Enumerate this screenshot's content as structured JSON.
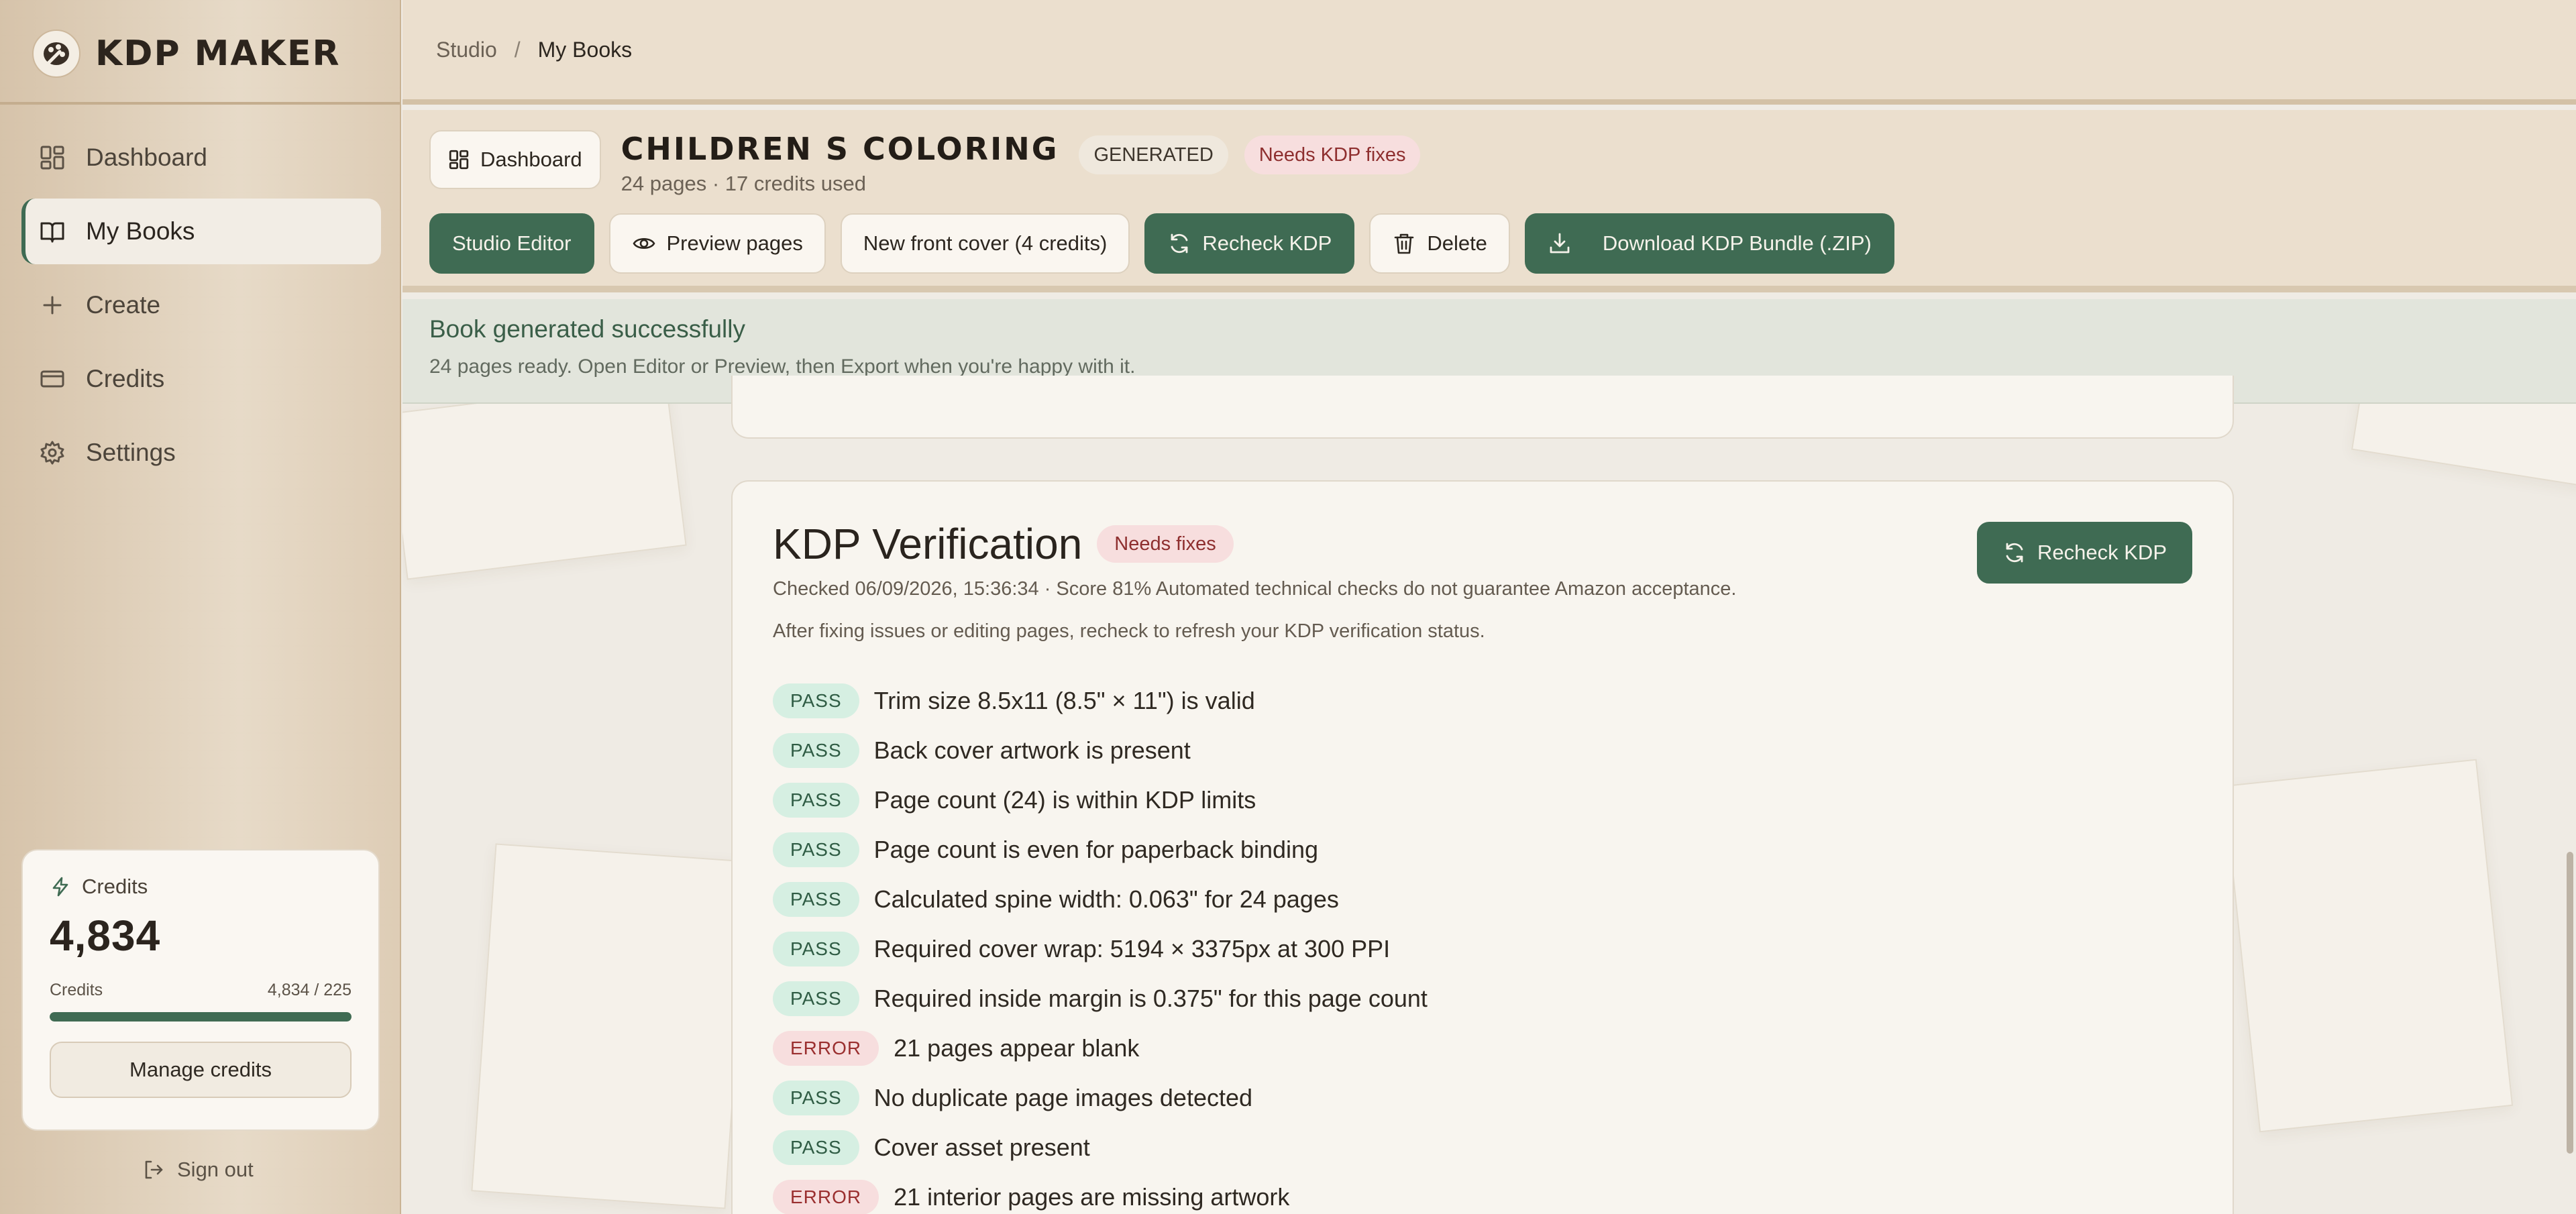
{
  "brand": {
    "name": "KDP MAKER",
    "logo_icon": "palette-brush-icon"
  },
  "sidebar": {
    "items": [
      {
        "label": "Dashboard",
        "icon": "dashboard-grid-icon",
        "active": false
      },
      {
        "label": "My Books",
        "icon": "book-open-icon",
        "active": true
      },
      {
        "label": "Create",
        "icon": "plus-icon",
        "active": false
      },
      {
        "label": "Credits",
        "icon": "credit-card-icon",
        "active": false
      },
      {
        "label": "Settings",
        "icon": "gear-icon",
        "active": false
      }
    ],
    "credits_card": {
      "heading": "Credits",
      "amount": "4,834",
      "row_label": "Credits",
      "row_value": "4,834 / 225",
      "progress": 1.0,
      "button_label": "Manage credits"
    },
    "signout_label": "Sign out"
  },
  "breadcrumb": {
    "root": "Studio",
    "separator": "/",
    "current": "My Books"
  },
  "book": {
    "back_button": "Dashboard",
    "title": "CHILDREN S COLORING",
    "subtitle": "24 pages · 17 credits used",
    "status_pill": "GENERATED",
    "warning_pill": "Needs KDP fixes"
  },
  "actions": {
    "studio_editor": "Studio Editor",
    "preview_pages": "Preview pages",
    "new_front_cover": "New front cover (4 credits)",
    "recheck_kdp": "Recheck KDP",
    "delete": "Delete",
    "download": "Download KDP Bundle (.ZIP)"
  },
  "alert": {
    "title": "Book generated successfully",
    "description": "24 pages ready. Open Editor or Preview, then Export when you're happy with it."
  },
  "verification": {
    "title": "KDP Verification",
    "badge": "Needs fixes",
    "recheck_label": "Recheck KDP",
    "meta": "Checked 06/09/2026, 15:36:34 · Score 81% Automated technical checks do not guarantee Amazon acceptance.",
    "meta2": "After fixing issues or editing pages, recheck to refresh your KDP verification status.",
    "checks": [
      {
        "status": "PASS",
        "text": "Trim size 8.5x11 (8.5\" × 11\") is valid"
      },
      {
        "status": "PASS",
        "text": "Back cover artwork is present"
      },
      {
        "status": "PASS",
        "text": "Page count (24) is within KDP limits"
      },
      {
        "status": "PASS",
        "text": "Page count is even for paperback binding"
      },
      {
        "status": "PASS",
        "text": "Calculated spine width: 0.063\" for 24 pages"
      },
      {
        "status": "PASS",
        "text": "Required cover wrap: 5194 × 3375px at 300 PPI"
      },
      {
        "status": "PASS",
        "text": "Required inside margin is 0.375\" for this page count"
      },
      {
        "status": "ERROR",
        "text": "21 pages appear blank"
      },
      {
        "status": "PASS",
        "text": "No duplicate page images detected"
      },
      {
        "status": "PASS",
        "text": "Cover asset present"
      },
      {
        "status": "ERROR",
        "text": "21 interior pages are missing artwork"
      }
    ]
  },
  "colors": {
    "accent": "#3f6b53",
    "pass_bg": "#d6efe2",
    "error_bg": "#f7dede",
    "sidebar_bg": "#dac7ae"
  }
}
